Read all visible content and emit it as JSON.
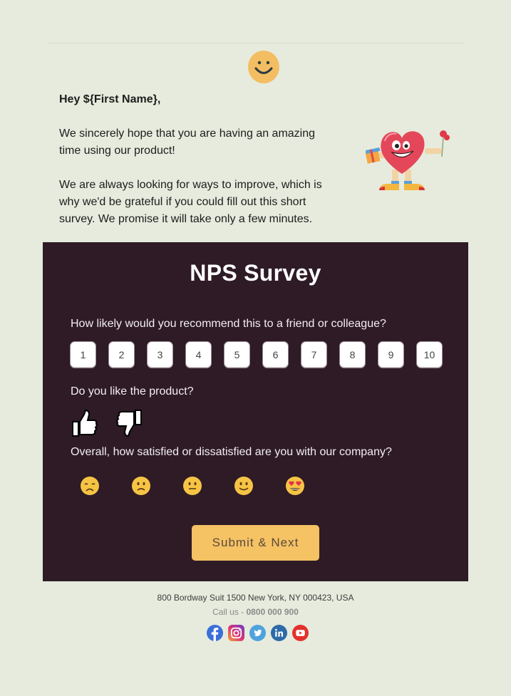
{
  "header": {
    "icon": "smiley-face-icon"
  },
  "intro": {
    "greeting": "Hey ${First Name},",
    "paragraph_1": "We sincerely hope that you are having an amazing time using our product!",
    "paragraph_2": "We are always looking for ways to improve, which is why we'd be grateful if you could fill out this short survey. We promise it will take only a few minutes.",
    "illustration": "heart-mascot-illustration"
  },
  "survey": {
    "title": "NPS Survey",
    "questions": {
      "recommend": {
        "label": "How likely would you recommend this to a friend or colleague?",
        "options": [
          "1",
          "2",
          "3",
          "4",
          "5",
          "6",
          "7",
          "8",
          "9",
          "10"
        ]
      },
      "like_product": {
        "label": "Do you like the product?",
        "options": [
          "thumbs-up-icon",
          "thumbs-down-icon"
        ]
      },
      "satisfaction": {
        "label": "Overall, how satisfied or dissatisfied are you with our company?",
        "options": [
          "disappointed-face",
          "slightly-frowning-face",
          "neutral-face",
          "slightly-smiling-face",
          "heart-eyes-face"
        ]
      }
    },
    "submit_label": "Submit & Next"
  },
  "footer": {
    "address": "800 Bordway Suit 1500 New York, NY 000423, USA",
    "call_prefix": "Call us - ",
    "phone": "0800 000 900",
    "socials": [
      "facebook",
      "instagram",
      "twitter",
      "linkedin",
      "youtube"
    ]
  },
  "colors": {
    "background": "#e6ebdd",
    "panel": "#2e1b26",
    "accent": "#f5c264"
  }
}
